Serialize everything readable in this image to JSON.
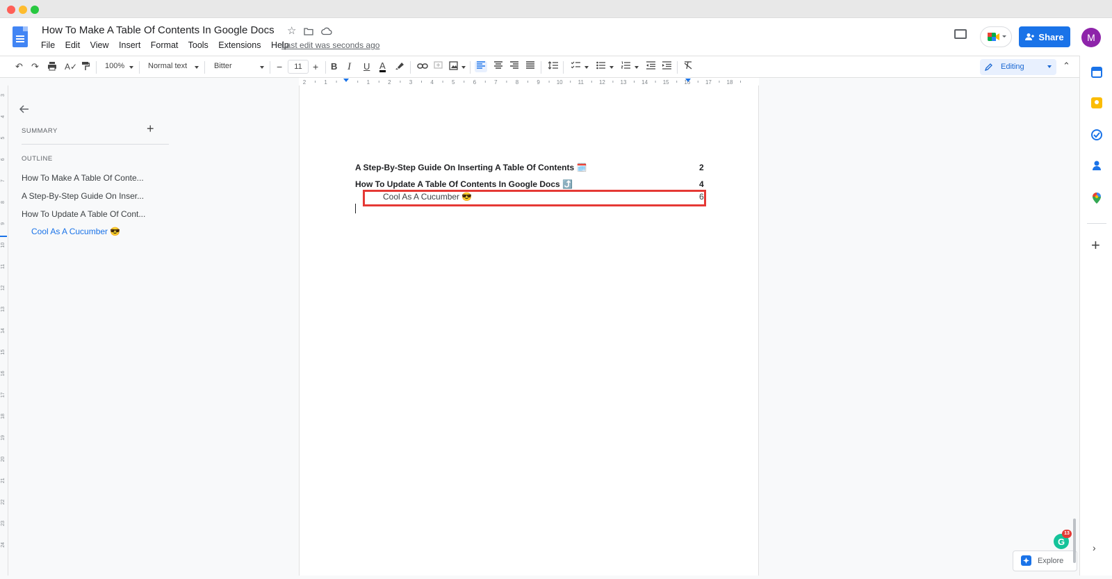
{
  "window": {
    "title_bar_dots": [
      "#ff5f57",
      "#febc2e",
      "#28c840"
    ]
  },
  "header": {
    "doc_title": "How To Make  A Table Of Contents In Google Docs",
    "menus": [
      "File",
      "Edit",
      "View",
      "Insert",
      "Format",
      "Tools",
      "Extensions",
      "Help"
    ],
    "last_edit": "Last edit was seconds ago",
    "share_label": "Share",
    "avatar_initial": "M"
  },
  "toolbar": {
    "zoom": "100%",
    "style": "Normal text",
    "font": "Bitter",
    "font_size": "11",
    "bold": "B",
    "italic": "I",
    "underline": "U",
    "text_color": "A",
    "mode": "Editing"
  },
  "ruler": {
    "ticks": [
      "2",
      "1",
      "",
      "1",
      "2",
      "3",
      "4",
      "5",
      "6",
      "7",
      "8",
      "9",
      "10",
      "11",
      "12",
      "13",
      "14",
      "15",
      "16",
      "17",
      "18"
    ],
    "vticks": [
      "3",
      "4",
      "5",
      "6",
      "7",
      "8",
      "9",
      "10",
      "11",
      "12",
      "13",
      "14",
      "15",
      "16",
      "17",
      "18",
      "19",
      "20",
      "21",
      "22",
      "23",
      "24"
    ]
  },
  "outline_panel": {
    "summary_label": "SUMMARY",
    "outline_label": "OUTLINE",
    "items": [
      "How To Make A Table Of Conte...",
      "A Step-By-Step Guide On Inser...",
      "How To Update A Table Of Cont...",
      "Cool As A Cucumber 😎"
    ]
  },
  "document": {
    "toc": [
      {
        "text": "A Step-By-Step Guide On Inserting A Table Of Contents 🗓️",
        "page": "2",
        "bold": true
      },
      {
        "text": "How To Update A Table Of Contents In Google Docs ⤴️",
        "page": "4",
        "bold": true
      },
      {
        "text": "Cool As A Cucumber 😎",
        "page": "6",
        "bold": false
      }
    ]
  },
  "sidebar": {
    "apps": [
      "calendar-icon",
      "keep-icon",
      "tasks-icon",
      "contacts-icon",
      "maps-icon"
    ],
    "colors": [
      "#1a73e8",
      "#fbbc04",
      "#1a73e8",
      "#1a73e8",
      "#34a853"
    ]
  },
  "explore": {
    "label": "Explore"
  },
  "grammarly": {
    "letter": "G",
    "count": "13"
  }
}
